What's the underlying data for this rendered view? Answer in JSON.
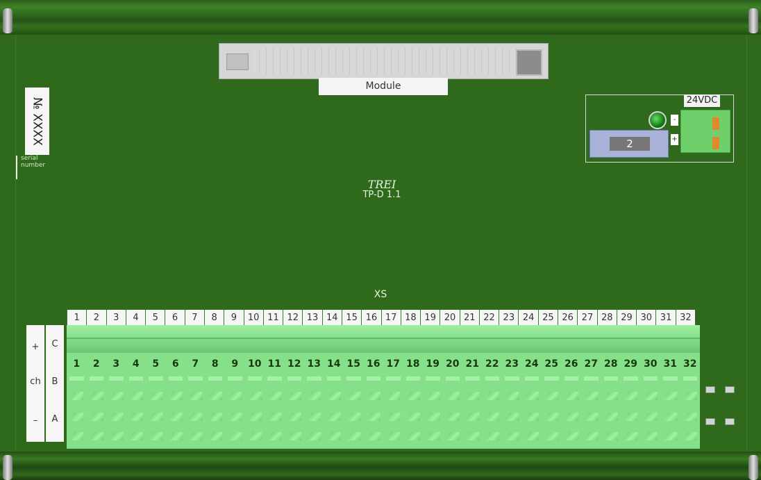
{
  "module": {
    "label": "Module"
  },
  "serial": {
    "number": "№ XXXX",
    "caption_line1": "serial",
    "caption_line2": "number"
  },
  "power": {
    "label": "24VDC",
    "fuse_value": "2",
    "minus": "-",
    "plus": "+"
  },
  "logo": {
    "brand": "TREI",
    "model": "TP-D 1.1"
  },
  "connector": {
    "label": "XS",
    "numbers": [
      "1",
      "2",
      "3",
      "4",
      "5",
      "6",
      "7",
      "8",
      "9",
      "10",
      "11",
      "12",
      "13",
      "14",
      "15",
      "16",
      "17",
      "18",
      "19",
      "20",
      "21",
      "22",
      "23",
      "24",
      "25",
      "26",
      "27",
      "28",
      "29",
      "30",
      "31",
      "32"
    ]
  },
  "rows": {
    "c": "C",
    "b": "B",
    "a": "A",
    "plus": "+",
    "ch": "ch",
    "minus": "–"
  },
  "terminals": {
    "numbers": [
      "1",
      "2",
      "3",
      "4",
      "5",
      "6",
      "7",
      "8",
      "9",
      "10",
      "11",
      "12",
      "13",
      "14",
      "15",
      "16",
      "17",
      "18",
      "19",
      "20",
      "21",
      "22",
      "23",
      "24",
      "25",
      "26",
      "27",
      "28",
      "29",
      "30",
      "31",
      "32"
    ]
  }
}
